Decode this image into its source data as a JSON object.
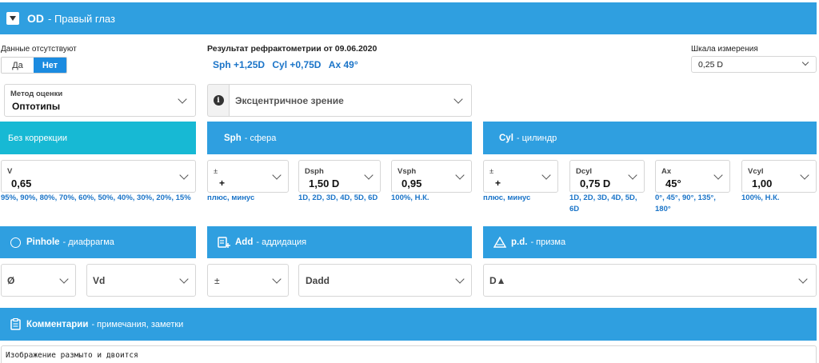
{
  "header": {
    "code": "OD",
    "title": "- Правый глаз"
  },
  "missing": {
    "label": "Данные отсутствуют",
    "yes": "Да",
    "no": "Нет"
  },
  "refraction": {
    "title": "Результат рефрактометрии от 09.06.2020",
    "sph_label": "Sph",
    "sph_value": "+1,25D",
    "cyl_label": "Cyl",
    "cyl_value": "+0,75D",
    "ax_label": "Ax",
    "ax_value": "49°"
  },
  "scale": {
    "label": "Шкала измерения",
    "value": "0,25 D"
  },
  "method": {
    "label": "Метод оценки",
    "value": "Оптотипы"
  },
  "eccentric": {
    "label": "Эксцентричное зрение"
  },
  "sections": {
    "no_correction": {
      "title": "Без коррекции"
    },
    "sph": {
      "title": "Sph",
      "subtitle": "- сфера"
    },
    "cyl": {
      "title": "Cyl",
      "subtitle": "- цилиндр"
    },
    "pinhole": {
      "title": "Pinhole",
      "subtitle": "- диафрагма"
    },
    "add": {
      "title": "Add",
      "subtitle": "- аддидация"
    },
    "pd": {
      "title": "p.d.",
      "subtitle": "- призма"
    },
    "comments": {
      "title": "Комментарии",
      "subtitle": "- примечания, заметки"
    }
  },
  "fields": {
    "v": {
      "label": "V",
      "value": "0,65",
      "hint": "95%, 90%, 80%, 70%, 60%, 50%, 40%, 30%, 20%, 15%"
    },
    "sph_sign": {
      "label": "±",
      "value": "+",
      "hint": "плюс, минус"
    },
    "dsph": {
      "label": "Dsph",
      "value": "1,50 D",
      "hint": "1D, 2D, 3D, 4D, 5D, 6D"
    },
    "vsph": {
      "label": "Vsph",
      "value": "0,95",
      "hint": "100%, Н.К."
    },
    "cyl_sign": {
      "label": "±",
      "value": "+",
      "hint": "плюс, минус"
    },
    "dcyl": {
      "label": "Dcyl",
      "value": "0,75 D",
      "hint1": "1D, 2D, 3D, 4D, 5D,",
      "hint2": "6D"
    },
    "ax": {
      "label": "Ax",
      "value": "45°",
      "hint1": "0°, 45°, 90°, 135°,",
      "hint2": "180°"
    },
    "vcyl": {
      "label": "Vcyl",
      "value": "1,00",
      "hint": "100%, Н.К."
    },
    "pinhole_phi": {
      "label": "Ø"
    },
    "vd": {
      "label": "Vd"
    },
    "add_sign": {
      "label": "±"
    },
    "dadd": {
      "label": "Dadd"
    },
    "d_prism": {
      "label": "D▲"
    }
  },
  "comment_text": "Изображение размыто и двоится",
  "colors": {
    "bar_blue": "#2f9fe0",
    "bar_teal": "#17b9d4",
    "toggle_active": "#1b8be0",
    "hint_blue": "#1a74c8"
  }
}
